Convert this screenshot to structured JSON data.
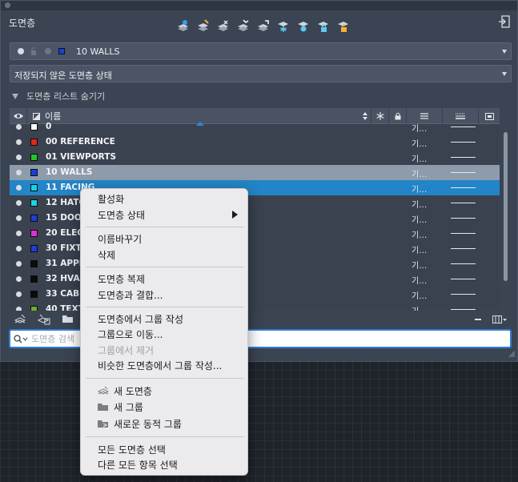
{
  "palette": {
    "title": "도면층"
  },
  "toolbar_top": {
    "icons": [
      "new-layer-icon",
      "new-layer-vp-frozen-icon",
      "delete-layer-icon",
      "set-current-icon",
      "layer-walk-icon",
      "freeze-icon",
      "layer-off-icon",
      "lock-icon",
      "unlock-icon"
    ]
  },
  "current_layer": {
    "name": "10 WALLS",
    "color": "#1c3fd9"
  },
  "layer_state": {
    "value": "저장되지 않은 도면층 상태"
  },
  "list_toggle": {
    "label": "도면층 리스트 숨기기"
  },
  "table": {
    "name_header": "이름",
    "rows": [
      {
        "name": "0",
        "color": "#ffffff",
        "linetype": "기…",
        "state": "normal"
      },
      {
        "name": "00 REFERENCE",
        "color": "#e0261f",
        "linetype": "기…",
        "state": "normal"
      },
      {
        "name": "01 VIEWPORTS",
        "color": "#22c52a",
        "linetype": "기…",
        "state": "normal"
      },
      {
        "name": "10 WALLS",
        "color": "#1c3fd9",
        "linetype": "기…",
        "state": "selected-gray"
      },
      {
        "name": "11 FACING",
        "color": "#17d4e4",
        "linetype": "기…",
        "state": "selected-blue"
      },
      {
        "name": "12 HATC",
        "color": "#17d4e4",
        "linetype": "기…",
        "state": "normal"
      },
      {
        "name": "15 DOOF",
        "color": "#1c3fd9",
        "linetype": "기…",
        "state": "normal"
      },
      {
        "name": "20 ELECT",
        "color": "#e22ed8",
        "linetype": "기…",
        "state": "normal"
      },
      {
        "name": "30 FIXTU",
        "color": "#1c3fd9",
        "linetype": "기…",
        "state": "normal"
      },
      {
        "name": "31 APPLI",
        "color": "#0c0c0c",
        "linetype": "기…",
        "state": "normal"
      },
      {
        "name": "32 HVAC",
        "color": "#0c0c0c",
        "linetype": "기…",
        "state": "normal"
      },
      {
        "name": "33 CABIN",
        "color": "#0c0c0c",
        "linetype": "기…",
        "state": "normal"
      },
      {
        "name": "40 TEXT",
        "color": "#6bb22a",
        "linetype": "기…",
        "state": "normal"
      }
    ]
  },
  "search": {
    "placeholder": "도면층 검색"
  },
  "context_menu": {
    "items": [
      {
        "label": "활성화"
      },
      {
        "label": "도면층 상태",
        "has_submenu": true
      },
      {
        "label": "이름바꾸기"
      },
      {
        "label": "삭제"
      },
      {
        "label": "도면층 복제"
      },
      {
        "label": "도면층과 결합..."
      },
      {
        "label": "도면층에서 그룹 작성"
      },
      {
        "label": "그룹으로 이동..."
      },
      {
        "label": "그룹에서 제거",
        "disabled": true
      },
      {
        "label": "비슷한 도면층에서 그룹 작성..."
      },
      {
        "label": "새 도면층",
        "icon": "new-layer-icon"
      },
      {
        "label": "새 그룹",
        "icon": "folder-icon"
      },
      {
        "label": "새로운 동적 그룹",
        "icon": "dynamic-group-folder-icon"
      },
      {
        "label": "모든 도면층 선택"
      },
      {
        "label": "다른 모든 항목 선택"
      }
    ]
  },
  "colors": {
    "palette_bg": "#3b4453",
    "selected_blue": "#2285c7",
    "selected_gray": "#8e9bab",
    "menu_bg": "#ebebed"
  }
}
